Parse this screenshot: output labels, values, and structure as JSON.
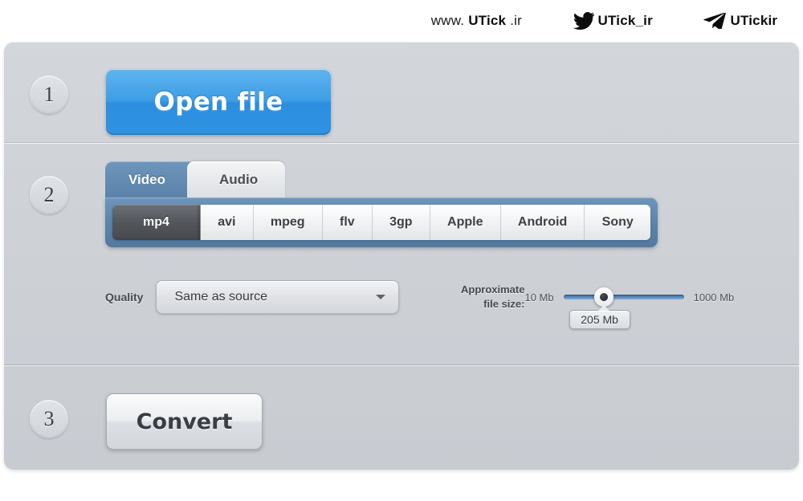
{
  "watermark": {
    "site": {
      "prefix": "www.",
      "name": "UTick",
      "suffix": ".ir"
    },
    "twitter": {
      "icon": "twitter-bird-icon",
      "handle": "UTick_ir"
    },
    "telegram": {
      "icon": "telegram-plane-icon",
      "handle": "UTickir"
    }
  },
  "steps": {
    "one": {
      "number": "1",
      "open_file_label": "Open file"
    },
    "two": {
      "number": "2",
      "tabs": [
        {
          "label": "Video",
          "active": true
        },
        {
          "label": "Audio",
          "active": false
        }
      ],
      "formats": [
        {
          "label": "mp4",
          "active": true
        },
        {
          "label": "avi",
          "active": false
        },
        {
          "label": "mpeg",
          "active": false
        },
        {
          "label": "flv",
          "active": false
        },
        {
          "label": "3gp",
          "active": false
        },
        {
          "label": "Apple",
          "active": false
        },
        {
          "label": "Android",
          "active": false
        },
        {
          "label": "Sony",
          "active": false
        }
      ],
      "quality": {
        "label": "Quality",
        "value": "Same as source",
        "caret_icon": "chevron-down-icon"
      },
      "filesize": {
        "label_line1": "Approximate",
        "label_line2": "file size:",
        "min_label": "10 Mb",
        "max_label": "1000 Mb",
        "current_value": "205 Mb"
      }
    },
    "three": {
      "number": "3",
      "convert_label": "Convert"
    }
  },
  "colors": {
    "accent_blue": "#2f93e2",
    "tab_blue": "#5b82a9",
    "panel_gray": "#ced1d6",
    "selected_format": "#54575c"
  }
}
